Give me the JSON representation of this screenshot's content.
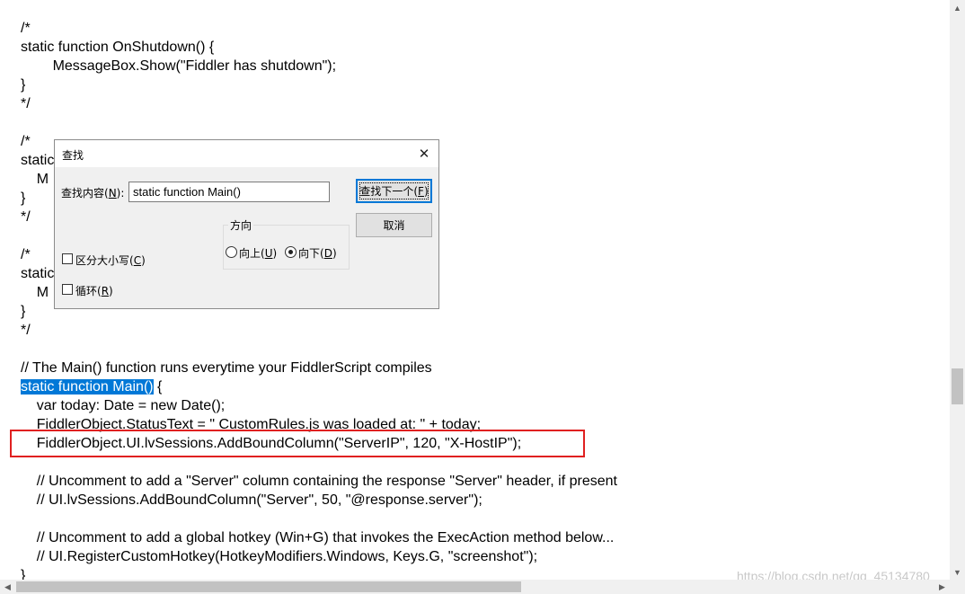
{
  "editor": {
    "lines": [
      "/*",
      "static function OnShutdown() {",
      "        MessageBox.Show(\"Fiddler has shutdown\");",
      "}",
      "*/",
      "",
      "/*",
      "static",
      "    M",
      "}",
      "*/",
      "",
      "/*",
      "static",
      "    M",
      "}",
      "*/",
      "",
      "// The Main() function runs everytime your FiddlerScript compiles",
      "",
      "    var today: Date = new Date();",
      "    FiddlerObject.StatusText = \" CustomRules.js was loaded at: \" + today;",
      "    FiddlerObject.UI.lvSessions.AddBoundColumn(\"ServerIP\", 120, \"X-HostIP\");",
      "",
      "    // Uncomment to add a \"Server\" column containing the response \"Server\" header, if present",
      "    // UI.lvSessions.AddBoundColumn(\"Server\", 50, \"@response.server\");",
      "",
      "    // Uncomment to add a global hotkey (Win+G) that invokes the ExecAction method below...",
      "    // UI.RegisterCustomHotkey(HotkeyModifiers.Windows, Keys.G, \"screenshot\");",
      "}"
    ],
    "selected_text": "static function Main()",
    "after_selection": " {",
    "partial_semicolon": ";"
  },
  "watermark": "https://blog.csdn.net/qq_45134780",
  "find_dialog": {
    "title": "查找",
    "close_glyph": "✕",
    "find_what_label": "查找内容(",
    "find_what_key": "N",
    "find_what_suffix": "):",
    "find_what_value": "static function Main()",
    "find_next_label": "查找下一个(",
    "find_next_key": "F",
    "find_next_suffix": ")",
    "cancel_label": "取消",
    "direction_label": "方向",
    "up_label": "向上(",
    "up_key": "U",
    "down_label": "向下(",
    "down_key": "D",
    "close_paren": ")",
    "match_case_label": "区分大小写(",
    "match_case_key": "C",
    "wrap_label": "循环(",
    "wrap_key": "R",
    "direction_selected": "down",
    "match_case_checked": false,
    "wrap_checked": false
  },
  "colors": {
    "selection": "#0078d7",
    "highlight_box": "#e02020"
  }
}
